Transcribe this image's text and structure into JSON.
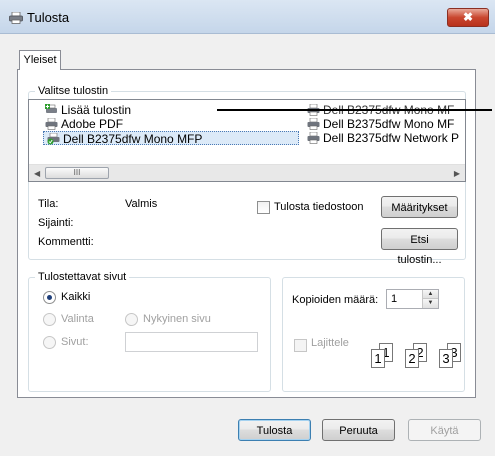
{
  "window": {
    "title": "Tulosta",
    "close_label": "✖"
  },
  "tab": {
    "label": "Yleiset"
  },
  "select_printer": {
    "group_label": "Valitse tulostin",
    "printers": [
      {
        "label": "Lisää tulostin",
        "icon": "add-printer-icon"
      },
      {
        "label": "Adobe PDF",
        "icon": "printer-icon"
      },
      {
        "label": "Dell B2375dfw Mono MFP",
        "icon": "default-printer-icon",
        "selected": true
      },
      {
        "label": "Dell B2375dfw Mono MF",
        "icon": "printer-icon"
      },
      {
        "label": "Dell B2375dfw Mono MF",
        "icon": "printer-icon"
      },
      {
        "label": "Dell B2375dfw Network P",
        "icon": "printer-icon"
      }
    ],
    "scroll_thumb": "III",
    "status_label": "Tila:",
    "status_value": "Valmis",
    "location_label": "Sijainti:",
    "comment_label": "Kommentti:",
    "print_to_file_label": "Tulosta tiedostoon",
    "preferences_button": "Määritykset",
    "find_printer_button": "Etsi tulostin..."
  },
  "page_range": {
    "group_label": "Tulostettavat sivut",
    "all_label": "Kaikki",
    "selection_label": "Valinta",
    "current_page_label": "Nykyinen sivu",
    "pages_label": "Sivut:",
    "pages_value": "",
    "selected": "all"
  },
  "copies": {
    "label": "Kopioiden määrä:",
    "value": "1",
    "collate_label": "Lajittele",
    "collate_pages": [
      "1",
      "1",
      "2",
      "2",
      "3",
      "3"
    ]
  },
  "footer": {
    "print_button": "Tulosta",
    "cancel_button": "Peruuta",
    "apply_button": "Käytä"
  }
}
